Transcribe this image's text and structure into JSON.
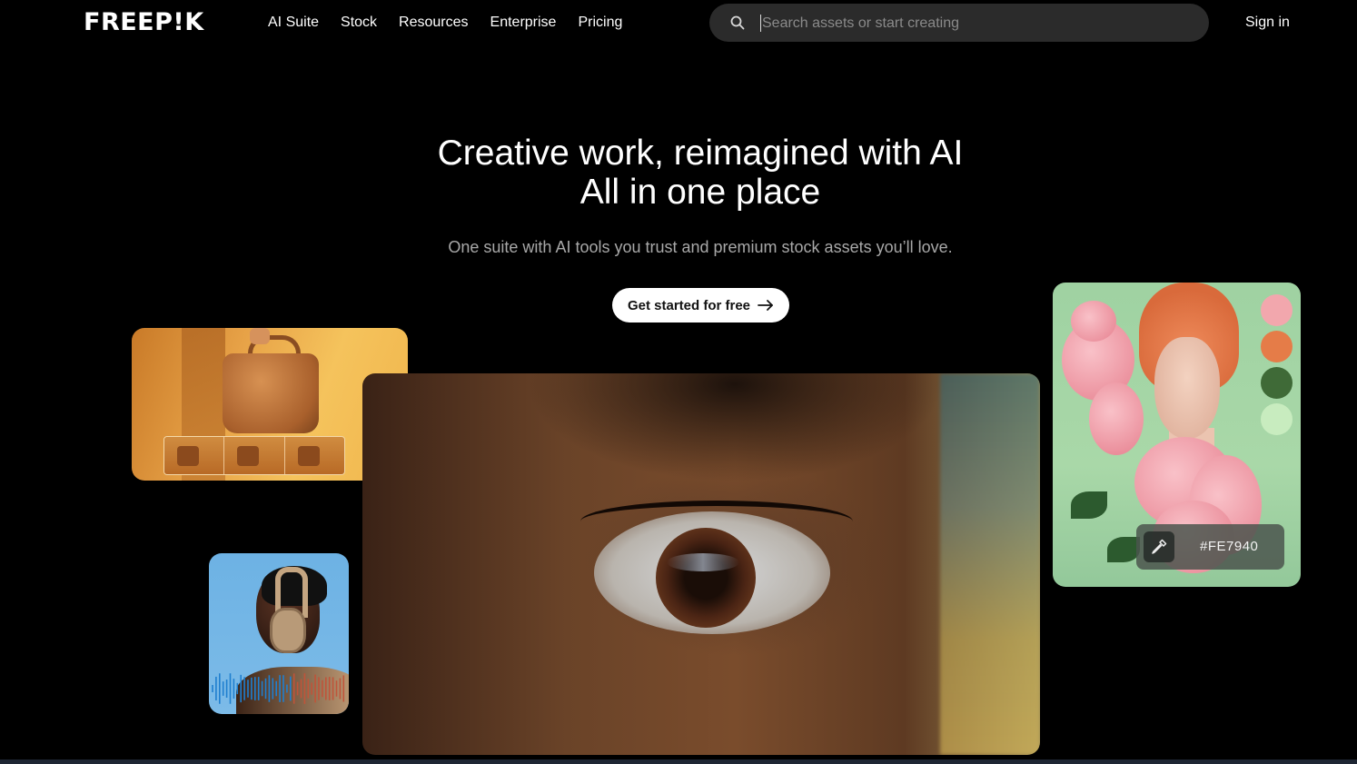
{
  "header": {
    "logo": "FREEP!K",
    "nav": [
      "AI Suite",
      "Stock",
      "Resources",
      "Enterprise",
      "Pricing"
    ],
    "search_placeholder": "Search assets or start creating",
    "search_value": "",
    "signin": "Sign in"
  },
  "hero": {
    "title_line1": "Creative work, reimagined with AI",
    "title_line2": "All in one place",
    "subtitle": "One suite with AI tools you trust and premium stock assets you’ll love.",
    "cta": "Get started for free"
  },
  "cards": {
    "color_picker_value": "#FE7940",
    "swatches": [
      "#f2a7ad",
      "#e57c48",
      "#3f6a37",
      "#c8ecbf"
    ]
  },
  "icons": {
    "search": "search-icon",
    "cta_arrow": "arrow-right-icon",
    "picker": "eyedropper-icon"
  }
}
